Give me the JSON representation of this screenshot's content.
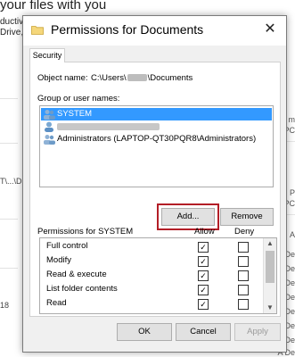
{
  "background": {
    "title": "your files with you",
    "line1": "ductiv",
    "line2": "Drive, f",
    "left_fragments": [
      "T\\...\\D",
      "18"
    ],
    "right_fragments": [
      "m",
      "PC",
      "hi P",
      "PC",
      "A",
      "A De",
      "A De",
      "A De",
      "A De",
      "A De",
      "A De",
      "A De",
      "A De"
    ]
  },
  "dialog": {
    "title": "Permissions for Documents",
    "close_glyph": "✕",
    "tab_security": "Security",
    "object_name_label": "Object name:",
    "object_name_prefix": "C:\\Users\\",
    "object_name_suffix": "\\Documents",
    "group_label": "Group or user names:",
    "principals": [
      {
        "name": "SYSTEM",
        "selected": true
      },
      {
        "name": "",
        "selected": false
      },
      {
        "name": "Administrators (LAPTOP-QT30PQR8\\Administrators)",
        "selected": false
      }
    ],
    "add_button": "Add...",
    "remove_button": "Remove",
    "permissions_for_label": "Permissions for SYSTEM",
    "allow_header": "Allow",
    "deny_header": "Deny",
    "permissions": [
      {
        "name": "Full control",
        "allow": true,
        "deny": false
      },
      {
        "name": "Modify",
        "allow": true,
        "deny": false
      },
      {
        "name": "Read & execute",
        "allow": true,
        "deny": false
      },
      {
        "name": "List folder contents",
        "allow": true,
        "deny": false
      },
      {
        "name": "Read",
        "allow": true,
        "deny": false
      }
    ],
    "check_glyph": "✓",
    "ok_button": "OK",
    "cancel_button": "Cancel",
    "apply_button": "Apply"
  },
  "colors": {
    "selection": "#3399ff",
    "highlight_box": "#b31e27"
  }
}
